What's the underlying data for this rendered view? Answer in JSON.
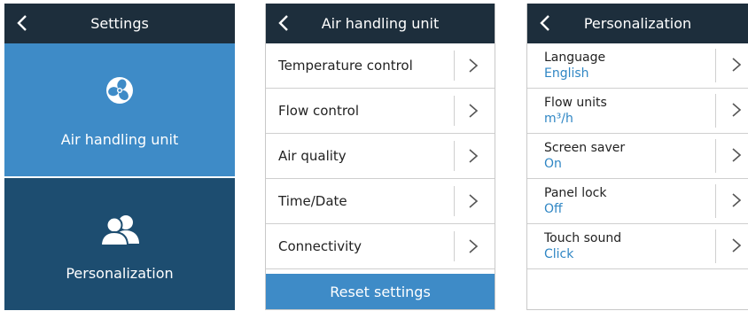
{
  "settings_screen": {
    "title": "Settings",
    "tiles": [
      {
        "label": "Air handling unit",
        "icon": "fan-icon",
        "color": "#3e8bc7"
      },
      {
        "label": "Personalization",
        "icon": "users-icon",
        "color": "#1d4d70"
      }
    ]
  },
  "ahu_screen": {
    "title": "Air handling unit",
    "items": [
      {
        "label": "Temperature control"
      },
      {
        "label": "Flow control"
      },
      {
        "label": "Air quality"
      },
      {
        "label": "Time/Date"
      },
      {
        "label": "Connectivity"
      }
    ],
    "reset_label": "Reset settings"
  },
  "personalization_screen": {
    "title": "Personalization",
    "items": [
      {
        "label": "Language",
        "value": "English"
      },
      {
        "label": "Flow units",
        "value": "m³/h"
      },
      {
        "label": "Screen saver",
        "value": "On"
      },
      {
        "label": "Panel lock",
        "value": "Off"
      },
      {
        "label": "Touch sound",
        "value": "Click"
      }
    ]
  },
  "colors": {
    "header": "#1d2e3c",
    "accent": "#3e8bc7",
    "dark_tile": "#1d4d70",
    "value_text": "#2f86c4"
  }
}
